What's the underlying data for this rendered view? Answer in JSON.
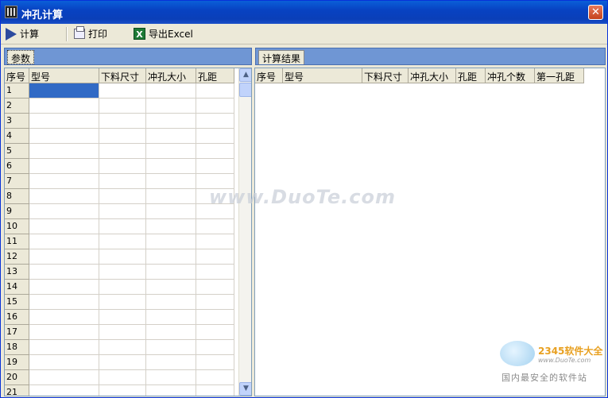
{
  "window": {
    "title": "冲孔计算",
    "close_glyph": "✕"
  },
  "toolbar": {
    "calc_label": "计算",
    "print_label": "打印",
    "export_label": "导出Excel"
  },
  "left_panel": {
    "tab_label": "参数",
    "columns": [
      "序号",
      "型号",
      "下料尺寸",
      "冲孔大小",
      "孔距"
    ],
    "row_numbers": [
      "1",
      "2",
      "3",
      "4",
      "5",
      "6",
      "7",
      "8",
      "9",
      "10",
      "11",
      "12",
      "13",
      "14",
      "15",
      "16",
      "17",
      "18",
      "19",
      "20",
      "21"
    ],
    "selected_row": 1,
    "selected_column": "型号"
  },
  "right_panel": {
    "tab_label": "计算结果",
    "columns": [
      "序号",
      "型号",
      "下料尺寸",
      "冲孔大小",
      "孔距",
      "冲孔个数",
      "第一孔距"
    ]
  },
  "scrollbar": {
    "up_glyph": "▲",
    "down_glyph": "▼"
  },
  "watermark": {
    "text": "www.DuoTe.com"
  },
  "logo": {
    "title": "2345软件大全",
    "url": "www.DuoTe.com",
    "subtitle": "国内最安全的软件站"
  },
  "colors": {
    "title_bar": "#0842c2",
    "selection": "#316ac5",
    "tab_strip": "#6f96d4",
    "close_button": "#c4421c"
  }
}
